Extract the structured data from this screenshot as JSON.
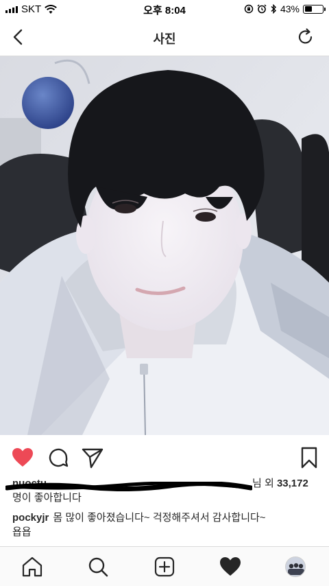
{
  "status_bar": {
    "carrier": "SKT",
    "time": "오후 8:04",
    "battery_percent_label": "43%",
    "battery_level": 0.43,
    "icons": [
      "signal-icon",
      "wifi-icon",
      "rotation-lock-icon",
      "alarm-icon",
      "bluetooth-icon",
      "battery-icon"
    ]
  },
  "nav": {
    "title": "사진",
    "back_icon": "chevron-left-icon",
    "refresh_icon": "refresh-icon"
  },
  "post": {
    "actions": {
      "like_icon": "heart-filled-icon",
      "like_color": "#ed4956",
      "comment_icon": "comment-icon",
      "share_icon": "send-icon",
      "save_icon": "bookmark-icon"
    },
    "likes": {
      "redacted_user_prefix": "nuoctu",
      "mid_text": "님 외",
      "count": "33,172",
      "suffix": "명이 좋아합니다"
    },
    "caption": {
      "username": "pockyjr",
      "text": "몸 많이 좋아졌습니다~ 걱정해주셔서 감사합니다~",
      "text_line2": "욥욥"
    }
  },
  "tab_bar": {
    "tabs": [
      "home-icon",
      "search-icon",
      "add-post-icon",
      "activity-heart-icon",
      "profile-avatar"
    ]
  }
}
